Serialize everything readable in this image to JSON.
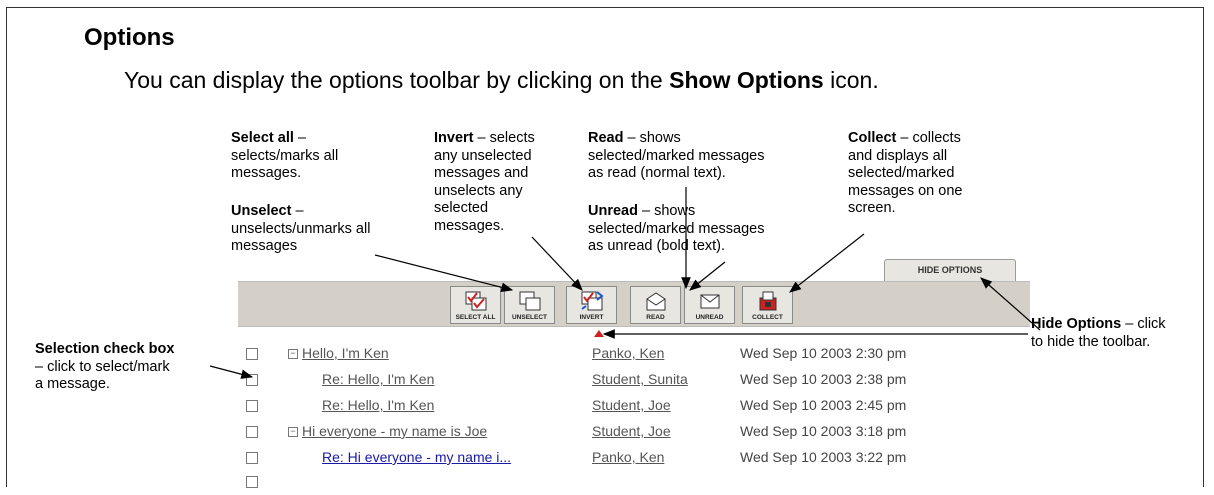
{
  "title": "Options",
  "intro": {
    "pre": "You can display the options toolbar by clicking on the ",
    "bold": "Show Options",
    "post": " icon."
  },
  "notes": {
    "select_all": {
      "term": "Select all",
      "desc": " –\nselects/marks all\nmessages."
    },
    "unselect": {
      "term": "Unselect",
      "desc": " –\nunselects/unmarks all\nmessages"
    },
    "invert": {
      "term": "Invert",
      "desc": " – selects\nany unselected\nmessages and\nunselects any\nselected\nmessages."
    },
    "read": {
      "term": "Read",
      "desc": " – shows\nselected/marked messages\nas read (normal text)."
    },
    "unread": {
      "term": "Unread",
      "desc": " – shows\nselected/marked messages\nas unread (bold text)."
    },
    "collect": {
      "term": "Collect",
      "desc": " – collects\nand displays all\nselected/marked\nmessages on one\nscreen."
    },
    "hide_options": {
      "term": "Hide Options",
      "desc": " – click\nto hide the toolbar."
    },
    "selection_checkbox": {
      "term": "Selection check box",
      "desc": "\n– click to select/mark\na message."
    }
  },
  "toolbar": {
    "hide_tab": "HIDE OPTIONS",
    "buttons": [
      {
        "label": "SELECT ALL",
        "icon": "select-all-icon"
      },
      {
        "label": "UNSELECT",
        "icon": "unselect-icon"
      },
      {
        "label": "INVERT",
        "icon": "invert-icon"
      },
      {
        "label": "READ",
        "icon": "read-envelope-icon"
      },
      {
        "label": "UNREAD",
        "icon": "unread-envelope-icon"
      },
      {
        "label": "COLLECT",
        "icon": "collect-icon"
      }
    ]
  },
  "messages": [
    {
      "subject": "Hello, I'm Ken",
      "author": "Panko, Ken",
      "date": "Wed Sep 10 2003 2:30 pm",
      "thread_root": true
    },
    {
      "subject": "Re: Hello, I'm Ken",
      "author": "Student, Sunita",
      "date": "Wed Sep 10 2003 2:38 pm",
      "thread_root": false
    },
    {
      "subject": "Re: Hello, I'm Ken",
      "author": "Student, Joe",
      "date": "Wed Sep 10 2003 2:45 pm",
      "thread_root": false
    },
    {
      "subject": "Hi everyone - my name is Joe",
      "author": "Student, Joe",
      "date": "Wed Sep 10 2003 3:18 pm",
      "thread_root": true
    },
    {
      "subject": "Re: Hi everyone - my name i...",
      "author": "Panko, Ken",
      "date": "Wed Sep 10 2003 3:22 pm",
      "thread_root": false
    }
  ],
  "colors": {
    "toolbar": "#d4d0c8",
    "link_unread": "#1a1aa6",
    "link_read": "#555555",
    "marker": "#cc2222"
  }
}
